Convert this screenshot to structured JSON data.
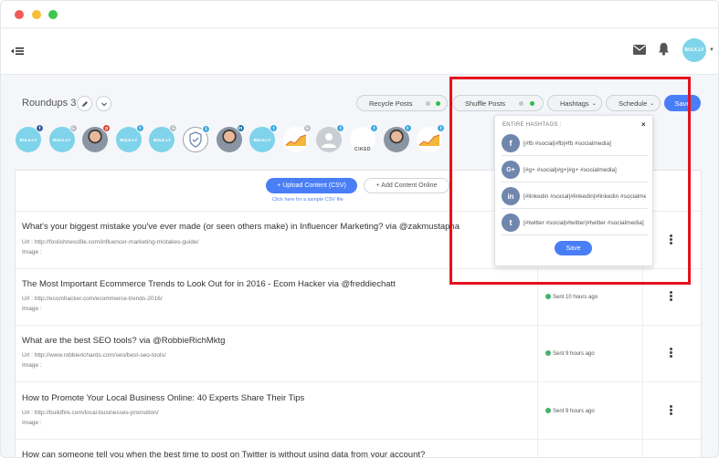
{
  "header": {
    "avatar_text": "BULK.LY"
  },
  "roundup": {
    "title": "Roundups 3"
  },
  "toolbar": {
    "recycle_label": "Recycle Posts",
    "shuffle_label": "Shuffle Posts",
    "hashtags_label": "Hashtags",
    "schedule_label": "Schedule",
    "save_label": "Save",
    "toggle_on_color": "#2fbf4a",
    "toggle_off_color": "#c3c7cc"
  },
  "accounts": [
    {
      "kind": "logo",
      "text": "BULK.LY",
      "network": "f"
    },
    {
      "kind": "logo",
      "text": "BULK.LY",
      "network": "G"
    },
    {
      "kind": "photo",
      "text": "",
      "network": "p"
    },
    {
      "kind": "logo",
      "text": "BULK.LY",
      "network": "t"
    },
    {
      "kind": "logo",
      "text": "BULK.LY",
      "network": "G"
    },
    {
      "kind": "shield",
      "text": "",
      "network": "t"
    },
    {
      "kind": "photo",
      "text": "",
      "network": "in"
    },
    {
      "kind": "logo",
      "text": "BULK.LY",
      "network": "t"
    },
    {
      "kind": "chart",
      "text": "",
      "network": "G"
    },
    {
      "kind": "silhouette",
      "text": "",
      "network": "t"
    },
    {
      "kind": "ciked",
      "text": "CIKED",
      "network": "t"
    },
    {
      "kind": "photo",
      "text": "",
      "network": "t"
    },
    {
      "kind": "chart",
      "text": "",
      "network": "t"
    }
  ],
  "content": {
    "upload_label": "+ Upload Content (CSV)",
    "add_online_label": "+ Add Content Online",
    "sample_csv_label": "Click here for a sample CSV file"
  },
  "posts": [
    {
      "title": "What's your biggest mistake you've ever made (or seen others make) in Influencer Marketing? via @zakmustapha",
      "url": "Url : http://foolishnessfile.com/influencer-marketing-mistakes-guide/",
      "image": "Image :",
      "status": ""
    },
    {
      "title": "The Most Important Ecommerce Trends to Look Out for in 2016 - Ecom Hacker via @freddiechatt",
      "url": "Url : http://ecomhacker.com/ecommerce-trends-2016/",
      "image": "Image :",
      "status": "Sent 10 hours ago"
    },
    {
      "title": "What are the best SEO tools? via @RobbieRichMktg",
      "url": "Url : http://www.robbierichards.com/seo/best-seo-tools/",
      "image": "Image :",
      "status": "Sent 9 hours ago"
    },
    {
      "title": "How to Promote Your Local Business Online: 40 Experts Share Their Tips",
      "url": "Url : http://buildfire.com/local-businesses-promotion/",
      "image": "Image :",
      "status": "Sent 9 hours ago"
    },
    {
      "title": "How can someone tell you when the best time to post on Twitter is without using data from your account?",
      "url": "",
      "image": "",
      "status": ""
    }
  ],
  "hashtags_popover": {
    "title": "ENTIRE HASHTAGS :",
    "close": "×",
    "rows": [
      {
        "network": "f",
        "tags": "[#fb #social|#fb|#fb #socialmedia]"
      },
      {
        "network": "G+",
        "tags": "[#g+ #social|#g+|#g+ #socialmedia]"
      },
      {
        "network": "in",
        "tags": "[#linkedin #social|#linkedin|#linkedin #socialmedia]"
      },
      {
        "network": "t",
        "tags": "[#twitter #social|#twitter|#twitter #socialmedia]"
      }
    ],
    "save_label": "Save"
  }
}
